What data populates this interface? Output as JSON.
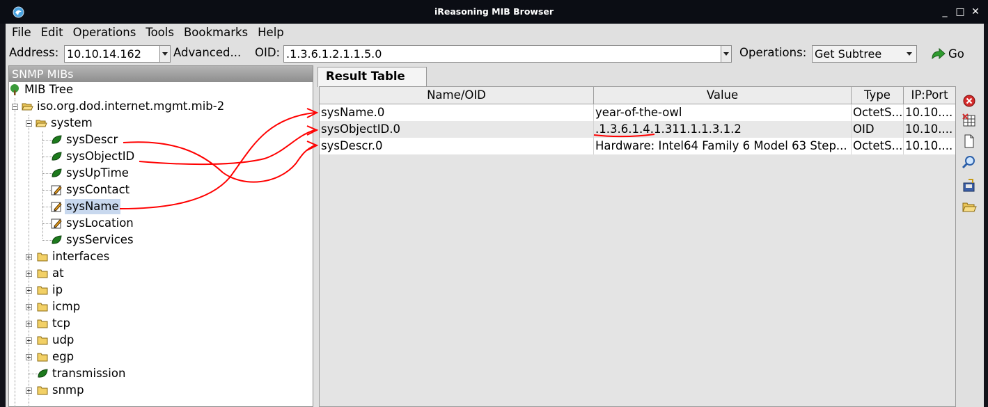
{
  "window": {
    "title": "iReasoning MIB Browser",
    "buttons": [
      "_",
      "□",
      "✕"
    ]
  },
  "menu": [
    "File",
    "Edit",
    "Operations",
    "Tools",
    "Bookmarks",
    "Help"
  ],
  "address_bar": {
    "address_label": "Address:",
    "address_value": "10.10.14.162",
    "advanced_label": "Advanced...",
    "oid_label": "OID:",
    "oid_value": ".1.3.6.1.2.1.1.5.0",
    "operations_label": "Operations:",
    "operation_value": "Get Subtree",
    "go_label": "Go"
  },
  "left_panel": {
    "header": "SNMP MIBs",
    "tree": [
      {
        "label": "MIB Tree",
        "icon": "tree-icon"
      },
      {
        "label": "iso.org.dod.internet.mgmt.mib-2",
        "icon": "folder-open-icon"
      },
      {
        "label": "system",
        "icon": "folder-open-icon"
      },
      {
        "label": "sysDescr",
        "icon": "leaf-icon"
      },
      {
        "label": "sysObjectID",
        "icon": "leaf-icon"
      },
      {
        "label": "sysUpTime",
        "icon": "leaf-icon"
      },
      {
        "label": "sysContact",
        "icon": "writable-leaf-icon"
      },
      {
        "label": "sysName",
        "icon": "writable-leaf-icon",
        "selected": true
      },
      {
        "label": "sysLocation",
        "icon": "writable-leaf-icon"
      },
      {
        "label": "sysServices",
        "icon": "leaf-icon"
      },
      {
        "label": "interfaces",
        "icon": "folder-icon"
      },
      {
        "label": "at",
        "icon": "folder-icon"
      },
      {
        "label": "ip",
        "icon": "folder-icon"
      },
      {
        "label": "icmp",
        "icon": "folder-icon"
      },
      {
        "label": "tcp",
        "icon": "folder-icon"
      },
      {
        "label": "udp",
        "icon": "folder-icon"
      },
      {
        "label": "egp",
        "icon": "folder-icon"
      },
      {
        "label": "transmission",
        "icon": "leaf-icon"
      },
      {
        "label": "snmp",
        "icon": "folder-icon"
      }
    ]
  },
  "result_tab": {
    "label": "Result Table"
  },
  "result_table": {
    "columns": [
      "Name/OID",
      "Value",
      "Type",
      "IP:Port"
    ],
    "rows": [
      [
        "sysName.0",
        "year-of-the-owl",
        "OctetS...",
        "10.10...."
      ],
      [
        "sysObjectID.0",
        ".1.3.6.1.4.1.311.1.1.3.1.2",
        "OID",
        "10.10...."
      ],
      [
        "sysDescr.0",
        "Hardware: Intel64 Family 6 Model 63 Step...",
        "OctetS...",
        "10.10...."
      ]
    ]
  },
  "side_toolbar": [
    "delete-icon",
    "clear-table-icon",
    "new-document-icon",
    "find-icon",
    "export-icon",
    "open-icon"
  ],
  "colors": {
    "titlebar": "#0b0d14",
    "annotation": "#ff0000",
    "selection": "#c8d8ee",
    "row_alt": "#e8e8e8"
  }
}
